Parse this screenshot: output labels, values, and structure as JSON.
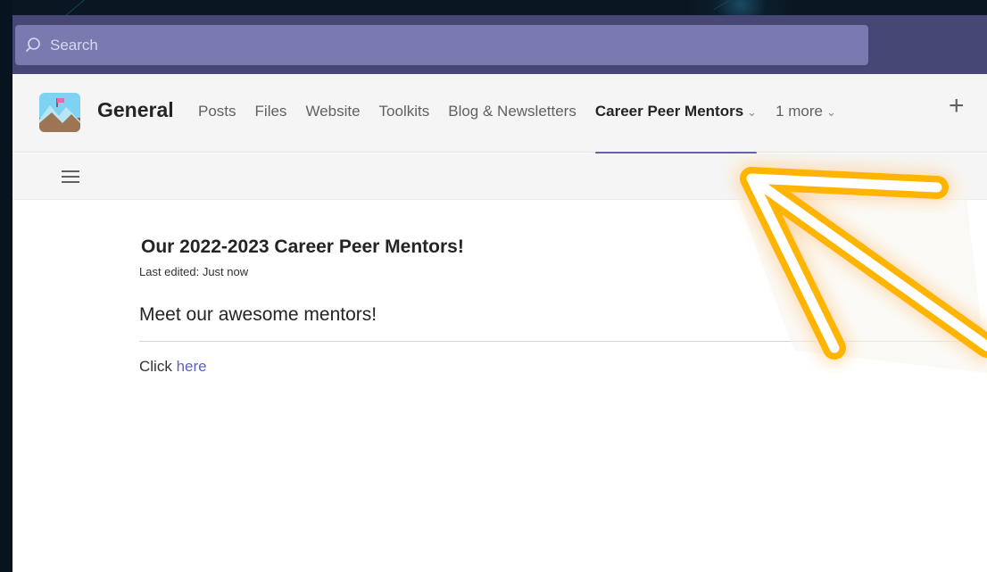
{
  "search": {
    "placeholder": "Search"
  },
  "channel": {
    "name": "General",
    "tabs": [
      {
        "label": "Posts",
        "active": false
      },
      {
        "label": "Files",
        "active": false
      },
      {
        "label": "Website",
        "active": false
      },
      {
        "label": "Toolkits",
        "active": false
      },
      {
        "label": "Blog & Newsletters",
        "active": false
      },
      {
        "label": "Career Peer Mentors",
        "active": true,
        "has_menu": true
      },
      {
        "label": "1 more",
        "active": false,
        "has_menu": true
      }
    ],
    "add_tab_icon": "plus-icon"
  },
  "page": {
    "title": "Our 2022-2023 Career Peer Mentors!",
    "last_edited": "Last edited: Just now",
    "section_heading": "Meet our awesome mentors!",
    "click_prefix": "Click",
    "click_link": "here"
  },
  "colors": {
    "titlebar": "#464775",
    "search_box": "#7a7ab0",
    "active_tab_underline": "#6264a7",
    "link": "#5b5fc7",
    "annotation_arrow": "#ffb400"
  },
  "annotation": {
    "icon": "arrow-annotation-icon",
    "points_to": "Career Peer Mentors"
  }
}
